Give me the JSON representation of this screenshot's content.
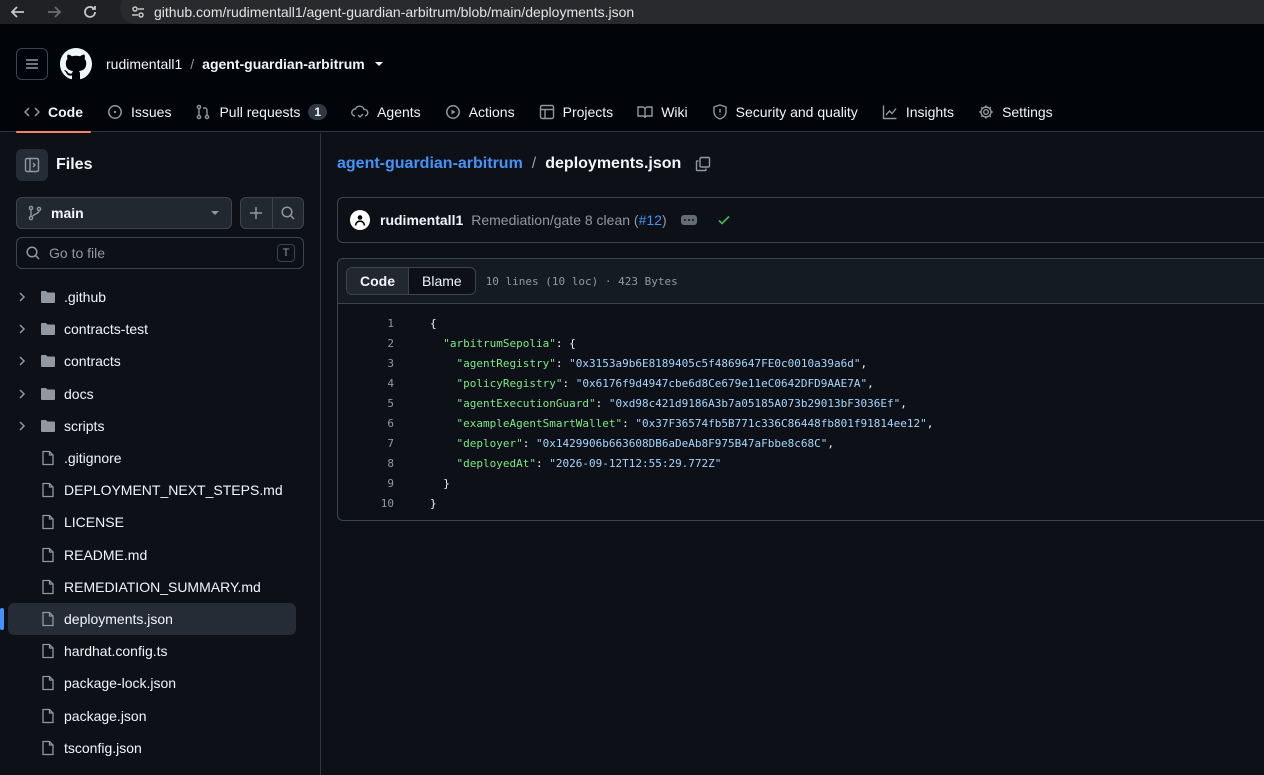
{
  "browser": {
    "url": "github.com/rudimentall1/agent-guardian-arbitrum/blob/main/deployments.json"
  },
  "header": {
    "owner": "rudimentall1",
    "separator": "/",
    "repo": "agent-guardian-arbitrum",
    "tabs": [
      {
        "label": "Code",
        "icon": "code-icon",
        "active": true
      },
      {
        "label": "Issues",
        "icon": "issue-opened-icon"
      },
      {
        "label": "Pull requests",
        "icon": "git-pull-request-icon",
        "count": "1"
      },
      {
        "label": "Agents",
        "icon": "agent-icon"
      },
      {
        "label": "Actions",
        "icon": "play-icon"
      },
      {
        "label": "Projects",
        "icon": "table-icon"
      },
      {
        "label": "Wiki",
        "icon": "book-icon"
      },
      {
        "label": "Security and quality",
        "icon": "shield-icon"
      },
      {
        "label": "Insights",
        "icon": "graph-icon"
      },
      {
        "label": "Settings",
        "icon": "gear-icon"
      }
    ]
  },
  "sidebar": {
    "title": "Files",
    "branch": "main",
    "search_placeholder": "Go to file",
    "search_shortcut": "T",
    "items": [
      {
        "name": ".github",
        "type": "dir"
      },
      {
        "name": "contracts-test",
        "type": "dir"
      },
      {
        "name": "contracts",
        "type": "dir"
      },
      {
        "name": "docs",
        "type": "dir"
      },
      {
        "name": "scripts",
        "type": "dir"
      },
      {
        "name": ".gitignore",
        "type": "file"
      },
      {
        "name": "DEPLOYMENT_NEXT_STEPS.md",
        "type": "file"
      },
      {
        "name": "LICENSE",
        "type": "file"
      },
      {
        "name": "README.md",
        "type": "file"
      },
      {
        "name": "REMEDIATION_SUMMARY.md",
        "type": "file"
      },
      {
        "name": "deployments.json",
        "type": "file",
        "selected": true
      },
      {
        "name": "hardhat.config.ts",
        "type": "file"
      },
      {
        "name": "package-lock.json",
        "type": "file"
      },
      {
        "name": "package.json",
        "type": "file"
      },
      {
        "name": "tsconfig.json",
        "type": "file"
      }
    ]
  },
  "main": {
    "path_repo": "agent-guardian-arbitrum",
    "path_sep": "/",
    "path_file": "deployments.json",
    "commit": {
      "author": "rudimentall1",
      "message": "Remediation/gate 8 clean (",
      "pr": "#12",
      "message_end": ")"
    },
    "file": {
      "tab_code": "Code",
      "tab_blame": "Blame",
      "meta": "10 lines (10 loc) · 423 Bytes",
      "lines": [
        {
          "n": "1",
          "indent": "",
          "key": "",
          "value": "",
          "rest": "{"
        },
        {
          "n": "2",
          "indent": "  ",
          "key": "\"arbitrumSepolia\"",
          "value": "",
          "rest": ": {"
        },
        {
          "n": "3",
          "indent": "    ",
          "key": "\"agentRegistry\"",
          "value": "\"0x3153a9b6E8189405c5f4869647FE0c0010a39a6d\"",
          "rest": ","
        },
        {
          "n": "4",
          "indent": "    ",
          "key": "\"policyRegistry\"",
          "value": "\"0x6176f9d4947cbe6d8Ce679e11eC0642DFD9AAE7A\"",
          "rest": ","
        },
        {
          "n": "5",
          "indent": "    ",
          "key": "\"agentExecutionGuard\"",
          "value": "\"0xd98c421d9186A3b7a05185A073b29013bF3036Ef\"",
          "rest": ","
        },
        {
          "n": "6",
          "indent": "    ",
          "key": "\"exampleAgentSmartWallet\"",
          "value": "\"0x37F36574fb5B771c336C86448fb801f91814ee12\"",
          "rest": ","
        },
        {
          "n": "7",
          "indent": "    ",
          "key": "\"deployer\"",
          "value": "\"0x1429906b663608DB6aDeAb8F975B47aFbbe8c68C\"",
          "rest": ","
        },
        {
          "n": "8",
          "indent": "    ",
          "key": "\"deployedAt\"",
          "value": "\"2026-09-12T12:55:29.772Z\"",
          "rest": ""
        },
        {
          "n": "9",
          "indent": "  ",
          "key": "",
          "value": "",
          "rest": "}"
        },
        {
          "n": "10",
          "indent": "",
          "key": "",
          "value": "",
          "rest": "}"
        }
      ]
    }
  },
  "colors": {
    "accent": "#4493f8",
    "active_tab_underline": "#f78166",
    "success": "#3fb950",
    "json_key": "#7ee787",
    "json_value": "#a5d6ff"
  }
}
